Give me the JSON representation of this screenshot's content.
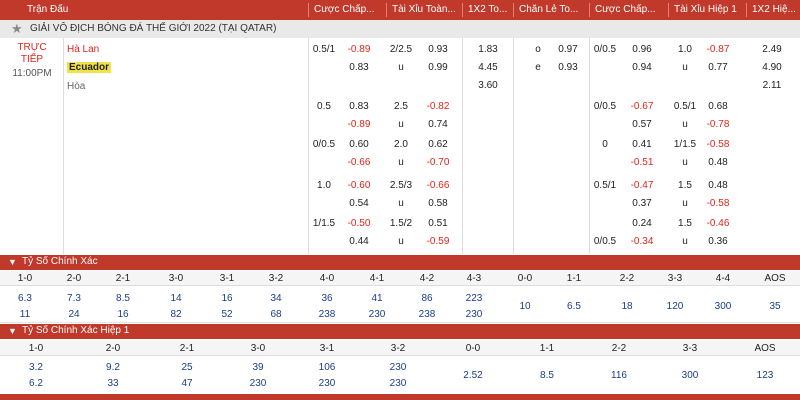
{
  "header": {
    "cols": [
      "Trận Đấu",
      "Cược Chấp...",
      "Tài Xỉu Toàn...",
      "1X2 To...",
      "Chẵn Lẻ To...",
      "Cược Chấp...",
      "Tài Xỉu Hiệp 1",
      "1X2 Hiệ..."
    ]
  },
  "league": {
    "name": "GIẢI VÔ ĐỊCH BÓNG ĐÁ THẾ GIỚI 2022 (TẠI QATAR)"
  },
  "match": {
    "status_line1": "TRỰC",
    "status_line2": "TIẾP",
    "time": "11:00PM",
    "home": "Hà Lan",
    "away": "Ecuador",
    "draw": "Hòa"
  },
  "odds_rows": [
    {
      "hc": "0.5/1",
      "hc_a": "-0.89",
      "hc_b": "0.83",
      "ou": "2/2.5",
      "ou_a": "0.93",
      "ou_lab": "u",
      "ou_b": "0.99",
      "x12": [
        "1.83",
        "4.45",
        "3.60"
      ],
      "oe": [
        {
          "l": "o",
          "v": "0.97"
        },
        {
          "l": "e",
          "v": "0.93"
        }
      ],
      "h1hc": "0/0.5",
      "h1hc_a": "0.96",
      "h1hc_b": "0.94",
      "h1ou": "1.0",
      "h1ou_a": "-0.87",
      "h1ou_lab": "u",
      "h1ou_b": "0.77",
      "h1x12": [
        "2.49",
        "4.90",
        "2.11"
      ]
    },
    {
      "hc": "0.5",
      "hc_a": "0.83",
      "hc_b": "-0.89",
      "ou": "2.5",
      "ou_a": "-0.82",
      "ou_lab": "u",
      "ou_b": "0.74",
      "h1hc": "0/0.5",
      "h1hc_a": "-0.67",
      "h1hc_b": "0.57",
      "h1ou": "0.5/1",
      "h1ou_a": "0.68",
      "h1ou_lab": "u",
      "h1ou_b": "-0.78"
    },
    {
      "hc": "0/0.5",
      "hc_a": "0.60",
      "hc_b": "-0.66",
      "ou": "2.0",
      "ou_a": "0.62",
      "ou_lab": "u",
      "ou_b": "-0.70",
      "h1hc": "0",
      "h1hc_a": "0.41",
      "h1hc_b": "-0.51",
      "h1ou": "1/1.5",
      "h1ou_a": "-0.58",
      "h1ou_lab": "u",
      "h1ou_b": "0.48"
    },
    {
      "hc": "1.0",
      "hc_a": "-0.60",
      "hc_b": "0.54",
      "ou": "2.5/3",
      "ou_a": "-0.66",
      "ou_lab": "u",
      "ou_b": "0.58",
      "h1hc": "0.5/1",
      "h1hc_a": "-0.47",
      "h1hc_b": "0.37",
      "h1ou": "1.5",
      "h1ou_a": "0.48",
      "h1ou_lab": "u",
      "h1ou_b": "-0.58"
    },
    {
      "hc": "1/1.5",
      "hc_a": "-0.50",
      "hc_b": "0.44",
      "ou": "1.5/2",
      "ou_a": "0.51",
      "ou_lab": "u",
      "ou_b": "-0.59",
      "h1hc_top": "",
      "h1hc": "0/0.5",
      "h1hc_a": "0.24",
      "h1hc_b": "-0.34",
      "h1ou": "1.5",
      "h1ou_a": "-0.46",
      "h1ou_lab": "u",
      "h1ou_b": "0.36"
    }
  ],
  "correct_score": {
    "title": "Tỷ Số Chính Xác",
    "labels": [
      "1-0",
      "2-0",
      "2-1",
      "3-0",
      "3-1",
      "3-2",
      "4-0",
      "4-1",
      "4-2",
      "4-3",
      "0-0",
      "1-1",
      "2-2",
      "3-3",
      "4-4",
      "AOS"
    ],
    "row1": [
      "6.3",
      "7.3",
      "8.5",
      "14",
      "16",
      "34",
      "36",
      "41",
      "86",
      "223"
    ],
    "row2": [
      "11",
      "24",
      "16",
      "82",
      "52",
      "68",
      "238",
      "230",
      "238",
      "230"
    ],
    "single": [
      "10",
      "6.5",
      "18",
      "120",
      "300",
      "35"
    ]
  },
  "correct_score_h1": {
    "title": "Tỷ Số Chính Xác Hiệp 1",
    "labels": [
      "1-0",
      "2-0",
      "2-1",
      "3-0",
      "3-1",
      "3-2",
      "0-0",
      "1-1",
      "2-2",
      "3-3",
      "AOS"
    ],
    "row1": [
      "3.2",
      "9.2",
      "25",
      "39",
      "106",
      "230"
    ],
    "row2": [
      "6.2",
      "33",
      "47",
      "230",
      "230",
      "230"
    ],
    "single": [
      "2.52",
      "8.5",
      "116",
      "300",
      "123"
    ]
  }
}
